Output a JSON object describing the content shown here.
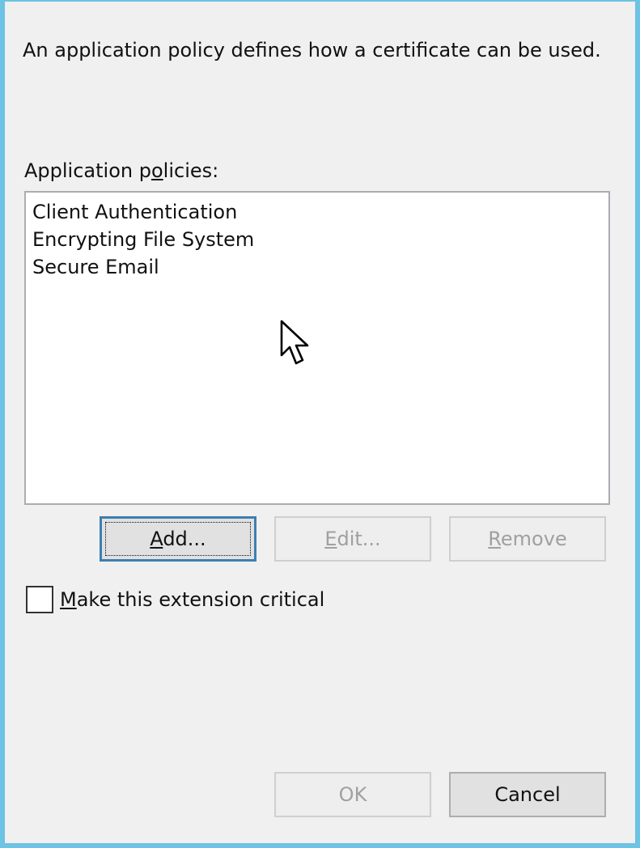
{
  "dialog": {
    "description": "An application policy defines how a certificate can be used.",
    "list_label_pre": "Application p",
    "list_label_accel": "o",
    "list_label_post": "licies:",
    "policies": [
      "Client Authentication",
      "Encrypting File System",
      "Secure Email"
    ],
    "buttons": {
      "add": {
        "accel": "A",
        "rest": "dd..."
      },
      "edit": {
        "accel": "E",
        "rest": "dit..."
      },
      "remove": {
        "accel": "R",
        "rest": "emove"
      }
    },
    "checkbox": {
      "accel": "M",
      "rest": "ake this extension critical",
      "checked": false
    },
    "ok_label": "OK",
    "cancel_label": "Cancel"
  },
  "colors": {
    "window_border": "#6cc3e3",
    "background": "#f0f0f0",
    "default_button_border": "#3c7fb1"
  },
  "icons": {
    "cursor": "arrow-cursor-icon"
  }
}
